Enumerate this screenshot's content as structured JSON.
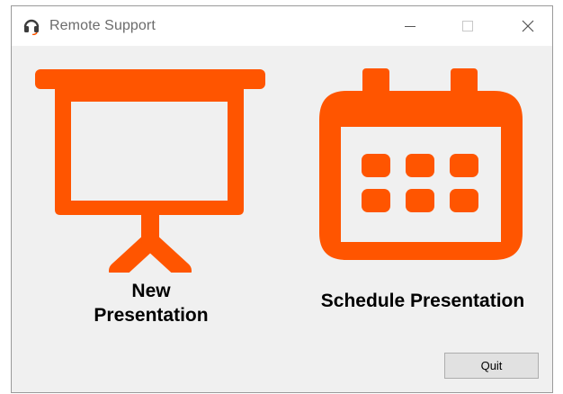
{
  "window": {
    "title": "Remote Support",
    "controls": {
      "minimize": "minimize-icon",
      "maximize": "maximize-icon",
      "close": "close-icon"
    }
  },
  "tiles": [
    {
      "label": "New\nPresentation",
      "icon": "presentation-board-icon"
    },
    {
      "label": "Schedule Presentation",
      "icon": "calendar-icon"
    }
  ],
  "quit_label": "Quit",
  "colors": {
    "accent": "#ff5500",
    "window_bg": "#f0f0f0",
    "titlebar_bg": "#ffffff"
  }
}
